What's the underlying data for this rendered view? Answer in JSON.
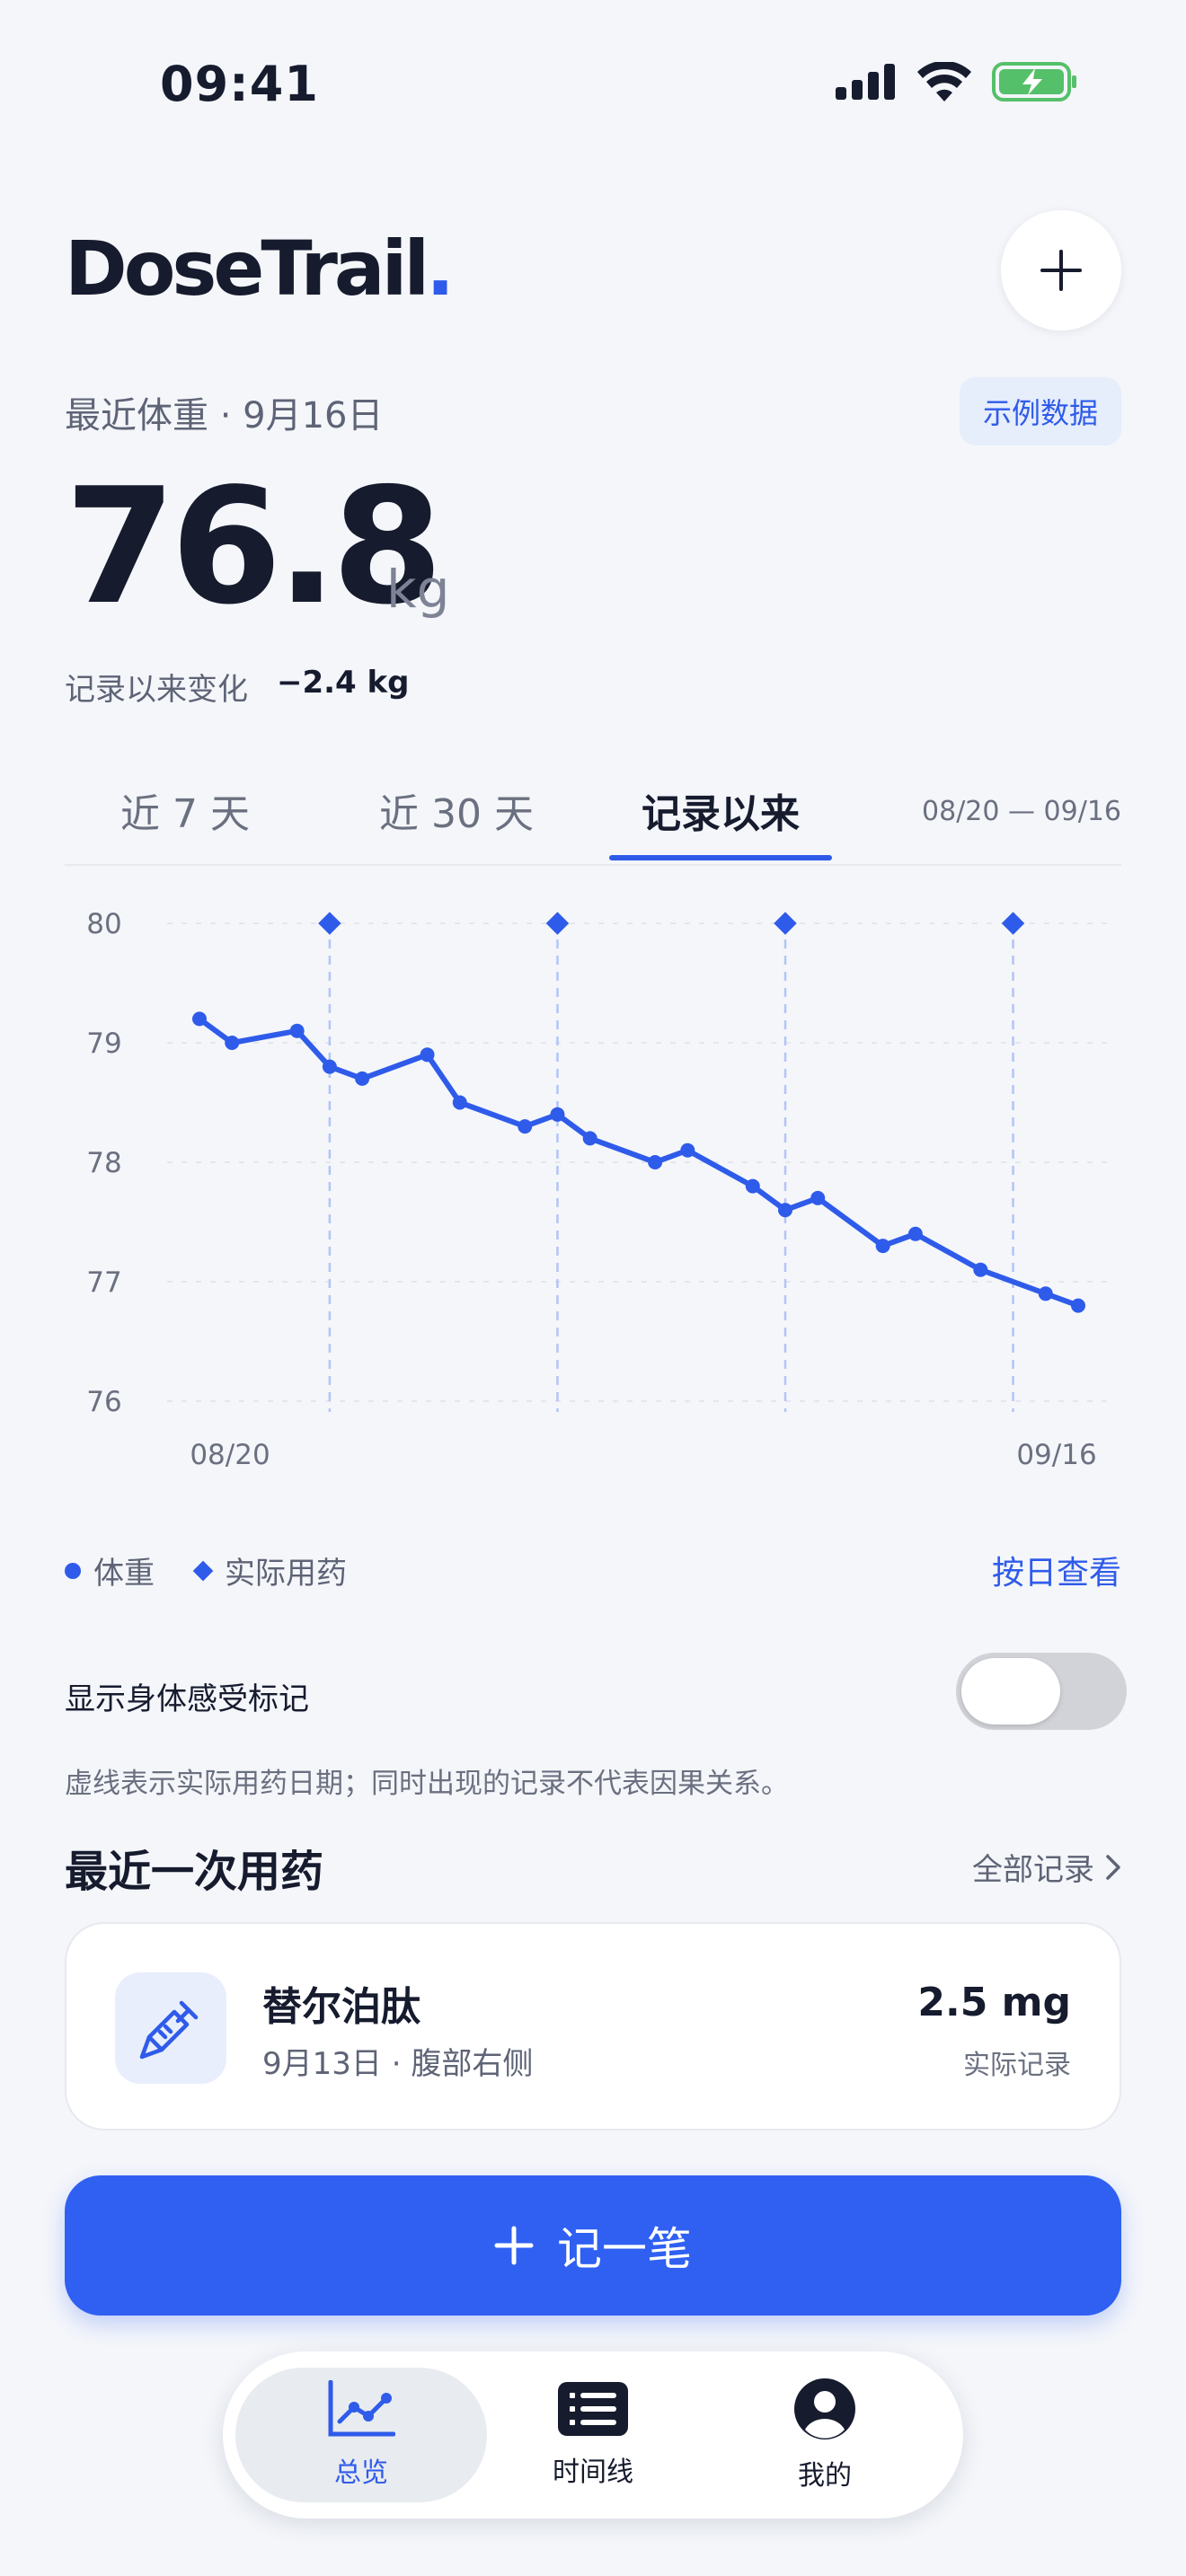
{
  "status_bar": {
    "time": "09:41"
  },
  "header": {
    "brand": "DoseTrail",
    "brand_dot": "."
  },
  "weight": {
    "section_label": "最近体重 · 9月16日",
    "sample_badge": "示例数据",
    "value": "76.8",
    "unit": "kg",
    "change_label": "记录以来变化",
    "change_value": "−2.4 kg"
  },
  "tabs": [
    {
      "label": "近 7 天",
      "active": false
    },
    {
      "label": "近 30 天",
      "active": false
    },
    {
      "label": "记录以来",
      "active": true
    }
  ],
  "range_label": "08/20 — 09/16",
  "chart_data": {
    "type": "line",
    "title": "",
    "xlabel": "",
    "ylabel": "",
    "ylim": [
      76,
      80
    ],
    "y_ticks": [
      "80",
      "79",
      "78",
      "77",
      "76"
    ],
    "x_tick_labels": [
      "08/20",
      "09/16"
    ],
    "grid": true,
    "series": [
      {
        "name": "体重",
        "color": "#2f5bea",
        "x": [
          "08/19",
          "08/20",
          "08/22",
          "08/23",
          "08/24",
          "08/26",
          "08/27",
          "08/29",
          "08/30",
          "08/31",
          "09/02",
          "09/03",
          "09/05",
          "09/06",
          "09/07",
          "09/09",
          "09/10",
          "09/12",
          "09/14",
          "09/15"
        ],
        "values": [
          79.2,
          79.0,
          79.1,
          78.8,
          78.7,
          78.9,
          78.5,
          78.3,
          78.4,
          78.2,
          78.0,
          78.1,
          77.8,
          77.6,
          77.7,
          77.3,
          77.4,
          77.1,
          76.9,
          76.8
        ]
      }
    ],
    "dose_markers": {
      "name": "实际用药",
      "x": [
        "08/23",
        "08/30",
        "09/06",
        "09/13"
      ]
    }
  },
  "legend": {
    "weight": "体重",
    "dose": "实际用药",
    "daily_link": "按日查看"
  },
  "toggle": {
    "label": "显示身体感受标记",
    "on": false
  },
  "note": "虚线表示实际用药日期；同时出现的记录不代表因果关系。",
  "recent": {
    "title": "最近一次用药",
    "all_link": "全部记录",
    "drug": "替尔泊肽",
    "meta": "9月13日 · 腹部右侧",
    "dose": "2.5 mg",
    "dose_note": "实际记录"
  },
  "primary_button": {
    "label": "记一笔"
  },
  "nav": [
    {
      "label": "总览",
      "icon": "chart-icon",
      "active": true
    },
    {
      "label": "时间线",
      "icon": "list-icon",
      "active": false
    },
    {
      "label": "我的",
      "icon": "profile-icon",
      "active": false
    }
  ],
  "colors": {
    "accent": "#2f5bea",
    "background": "#f4f6fa",
    "text": "#161b2e"
  }
}
